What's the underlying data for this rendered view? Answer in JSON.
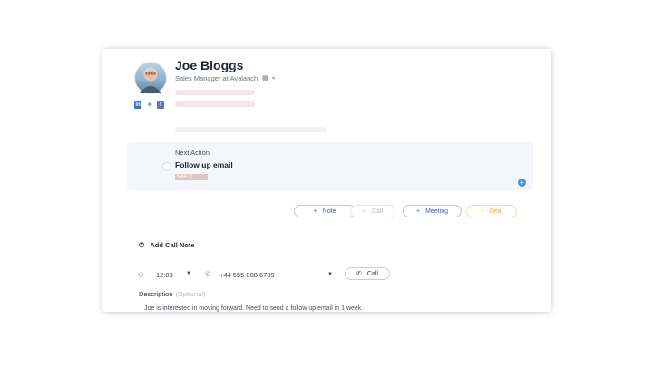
{
  "contact": {
    "name": "Joe Bloggs",
    "subtitle": "Sales Manager at Avalanch",
    "star_icon": "star-icon",
    "company_icon": "building-icon",
    "social": [
      "linkedin-icon",
      "twitter-icon",
      "facebook-icon"
    ]
  },
  "next_action": {
    "label": "Next Action",
    "title": "Follow up email",
    "tag": "MAR 01"
  },
  "actions": {
    "note": "Note",
    "call": "Call",
    "meeting": "Meeting",
    "deal": "Deal"
  },
  "call_note": {
    "heading": "Add Call Note",
    "time": "12:03",
    "phone": "+44 555 008 6789",
    "call_button": "Call",
    "description_label": "Description",
    "description_optional": "(Optional)",
    "description_text": "Joe is interested in moving forward. Need to send a follow up email in 1 week."
  },
  "colors": {
    "note": "#3f5fb0",
    "call": "#b6bcc6",
    "meeting": "#3f5fb0",
    "deal": "#f0a24a",
    "accent": "#4a90e2"
  }
}
